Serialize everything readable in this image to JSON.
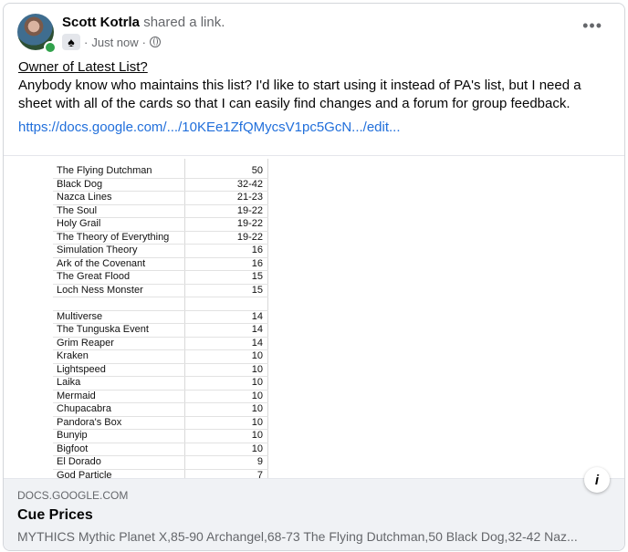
{
  "post": {
    "author_name": "Scott Kotrla",
    "action": "shared a link.",
    "time": "Just now",
    "separator": "·",
    "spade_icon": "♠",
    "title": "Owner of Latest List?",
    "body": "Anybody know who maintains this list? I'd like to start using it instead of PA's list, but I need a sheet with all of the cards so that I can easily find changes and a forum for group feedback.",
    "link": "https://docs.google.com/.../10KEe1ZfQMycsV1pc5GcN.../edit..."
  },
  "sheet": {
    "rows": [
      {
        "name": "The Flying Dutchman",
        "price": "50"
      },
      {
        "name": "Black Dog",
        "price": "32-42"
      },
      {
        "name": "Nazca Lines",
        "price": "21-23"
      },
      {
        "name": "The Soul",
        "price": "19-22"
      },
      {
        "name": "Holy Grail",
        "price": "19-22"
      },
      {
        "name": "The Theory of Everything",
        "price": "19-22"
      },
      {
        "name": "Simulation Theory",
        "price": "16"
      },
      {
        "name": "Ark of the Covenant",
        "price": "16"
      },
      {
        "name": "The Great Flood",
        "price": "15"
      },
      {
        "name": "Loch Ness Monster",
        "price": "15"
      },
      {
        "name": "",
        "price": ""
      },
      {
        "name": "Multiverse",
        "price": "14"
      },
      {
        "name": "The Tunguska Event",
        "price": "14"
      },
      {
        "name": "Grim Reaper",
        "price": "14"
      },
      {
        "name": "Kraken",
        "price": "10"
      },
      {
        "name": "Lightspeed",
        "price": "10"
      },
      {
        "name": "Laika",
        "price": "10"
      },
      {
        "name": "Mermaid",
        "price": "10"
      },
      {
        "name": "Chupacabra",
        "price": "10"
      },
      {
        "name": "Pandora's Box",
        "price": "10"
      },
      {
        "name": "Bunyip",
        "price": "10"
      },
      {
        "name": "Bigfoot",
        "price": "10"
      },
      {
        "name": "El Dorado",
        "price": "9"
      },
      {
        "name": "God Particle",
        "price": "7"
      }
    ]
  },
  "preview": {
    "domain": "DOCS.GOOGLE.COM",
    "title": "Cue Prices",
    "description": "MYTHICS Mythic Planet X,85-90 Archangel,68-73 The Flying Dutchman,50 Black Dog,32-42 Naz..."
  },
  "icons": {
    "more": "more-options-icon",
    "privacy": "globe-icon",
    "info": "info-icon"
  }
}
